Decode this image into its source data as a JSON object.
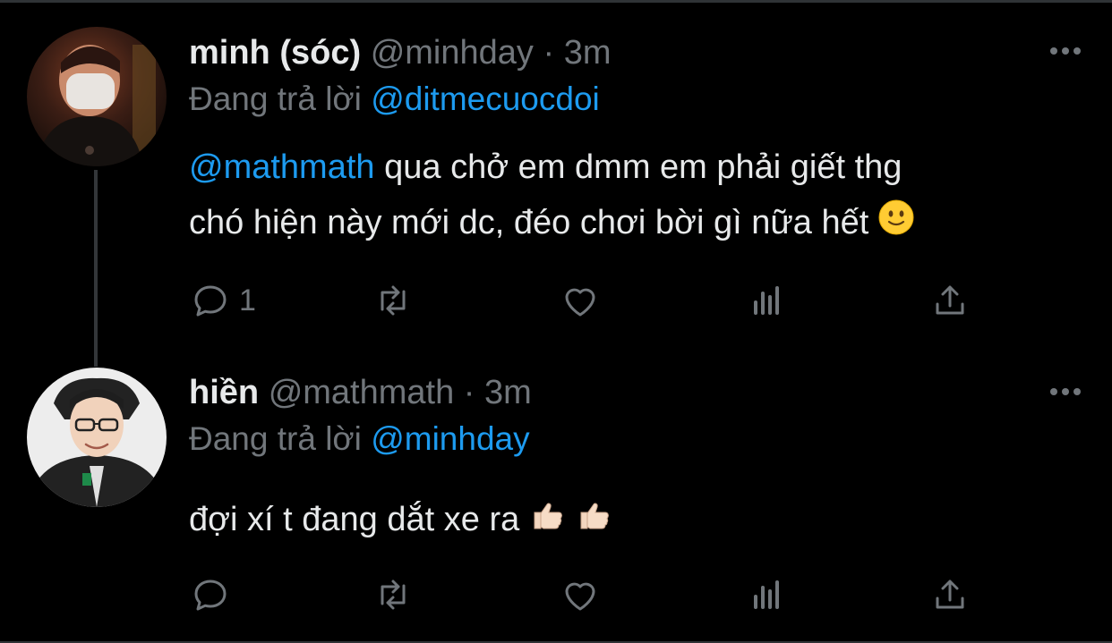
{
  "tweets": [
    {
      "name": "minh (sóc)",
      "handle": "@minhday",
      "separator": "·",
      "time": "3m",
      "reply_prefix": "Đang trả lời",
      "reply_to": "@ditmecuocdoi",
      "mention": "@mathmath",
      "text_line1": "qua chở em dmm em phải giết thg",
      "text_line2": "chó hiện này mới dc, đéo chơi bời gì nữa hết",
      "emoji": "slightly-smiling-face",
      "reply_count": "1"
    },
    {
      "name": "hiền",
      "handle": "@mathmath",
      "separator": "·",
      "time": "3m",
      "reply_prefix": "Đang trả lời",
      "reply_to": "@minhday",
      "text": "đợi xí t đang dắt xe ra",
      "emoji": "thumbs-up x2"
    }
  ],
  "colors": {
    "background": "#000000",
    "text": "#e7e9ea",
    "muted": "#71767b",
    "link": "#1d9bf0",
    "thread_line": "#333639"
  },
  "icons": [
    "reply-icon",
    "retweet-icon",
    "like-icon",
    "analytics-icon",
    "share-icon",
    "more-icon"
  ]
}
